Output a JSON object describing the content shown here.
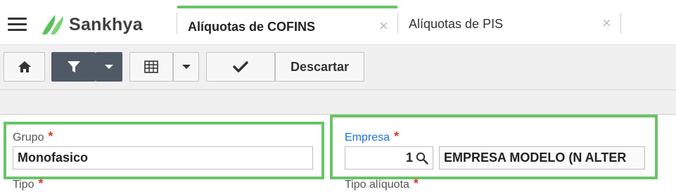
{
  "header": {
    "logo_text": "Sankhya",
    "tabs": [
      {
        "label": "Alíquotas de COFINS",
        "active": true
      },
      {
        "label": "Alíquotas de PIS",
        "active": false
      }
    ],
    "close_glyph": "×"
  },
  "toolbar": {
    "discard_label": "Descartar"
  },
  "form": {
    "grupo": {
      "label": "Grupo",
      "required_mark": "*",
      "value": "Monofasico"
    },
    "empresa": {
      "label": "Empresa",
      "required_mark": "*",
      "code": "1",
      "name": "EMPRESA MODELO (N ALTER"
    },
    "tipo": {
      "label": "Tipo",
      "required_mark": "*"
    },
    "tipo_aliquota": {
      "label": "Tipo alíquota",
      "required_mark": "*"
    }
  },
  "colors": {
    "accent_green": "#6ac46a",
    "link_blue": "#1b72d6",
    "required_red": "#d93a2b",
    "dark_button": "#505a66"
  },
  "icons": [
    "menu-icon",
    "sankhya-logo-icon",
    "close-icon",
    "home-icon",
    "filter-icon",
    "chevron-down-icon",
    "grid-icon",
    "checkmark-icon",
    "search-icon"
  ]
}
